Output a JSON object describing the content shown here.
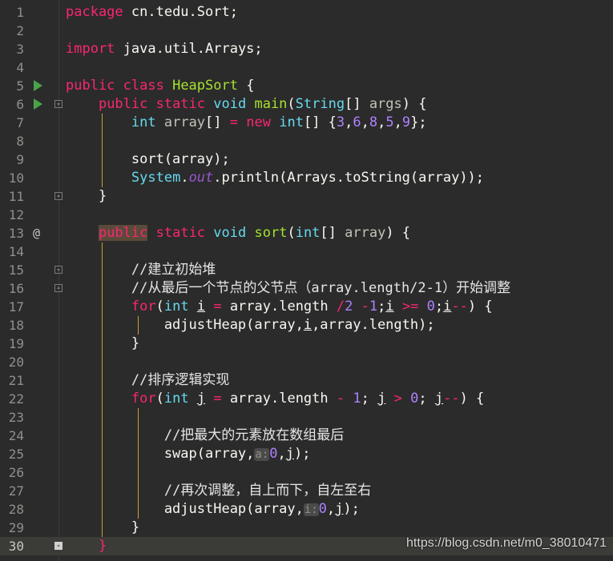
{
  "editor": {
    "file_class": "HeapSort",
    "current_line": 30
  },
  "lines": [
    {
      "n": "1",
      "html": "<span class=\"kw\">package</span> cn.tedu.Sort;"
    },
    {
      "n": "2",
      "html": ""
    },
    {
      "n": "3",
      "html": "<span class=\"kw\">import</span> java.util.Arrays;"
    },
    {
      "n": "4",
      "html": ""
    },
    {
      "n": "5",
      "html": "<span class=\"kw\">public class</span> <span class=\"fn\">HeapSort</span> {"
    },
    {
      "n": "6",
      "html": "    <span class=\"kw\">public static</span> <span class=\"ty\">void</span> <span class=\"fn\">main</span>(<span class=\"ty\">String</span>[] <span class=\"pm\">args</span>) {"
    },
    {
      "n": "7",
      "html": "        <span class=\"ty\">int</span> <span class=\"pm\">array</span>[] <span class=\"kw\">=</span> <span class=\"kw\">new</span> <span class=\"ty\">int</span>[] {<span class=\"num\">3</span>,<span class=\"num\">6</span>,<span class=\"num\">8</span>,<span class=\"num\">5</span>,<span class=\"num\">9</span>};"
    },
    {
      "n": "8",
      "html": ""
    },
    {
      "n": "9",
      "html": "        sort(array);"
    },
    {
      "n": "10",
      "html": "        <span class=\"ty\">System</span>.<span class=\"fld\">out</span>.println(Arrays.toString(array));"
    },
    {
      "n": "11",
      "html": "    }"
    },
    {
      "n": "12",
      "html": ""
    },
    {
      "n": "13",
      "html": "    <span class=\"kw hl\">public</span> <span class=\"kw\">static</span> <span class=\"ty\">void</span> <span class=\"fn\">sort</span>(<span class=\"ty\">int</span>[] <span class=\"pm\">array</span>) {"
    },
    {
      "n": "14",
      "html": ""
    },
    {
      "n": "15",
      "html": "        <span class=\"cmt\">//建立初始堆</span>"
    },
    {
      "n": "16",
      "html": "        <span class=\"cmt\">//从最后一个节点的父节点（array.length/2-1）开始调整</span>"
    },
    {
      "n": "17",
      "html": "        <span class=\"kw\">for</span>(<span class=\"ty\">int</span> <span class=\"u\">i</span> <span class=\"kw\">=</span> array.length <span class=\"kw\">/</span><span class=\"num\">2</span> <span class=\"kw\">-</span><span class=\"num\">1</span>;<span class=\"u\">i</span> <span class=\"kw\">&gt;=</span> <span class=\"num\">0</span>;<span class=\"u\">i</span><span class=\"kw\">--</span>) {"
    },
    {
      "n": "18",
      "html": "            adjustHeap(array,<span class=\"u\">i</span>,array.length);"
    },
    {
      "n": "19",
      "html": "        }"
    },
    {
      "n": "20",
      "html": ""
    },
    {
      "n": "21",
      "html": "        <span class=\"cmt\">//排序逻辑实现</span>"
    },
    {
      "n": "22",
      "html": "        <span class=\"kw\">for</span>(<span class=\"ty\">int</span> <span class=\"u\">j</span> <span class=\"kw\">=</span> array.length <span class=\"kw\">-</span> <span class=\"num\">1</span>; <span class=\"u\">j</span> <span class=\"kw\">&gt;</span> <span class=\"num\">0</span>; <span class=\"u\">j</span><span class=\"kw\">--</span>) {"
    },
    {
      "n": "23",
      "html": ""
    },
    {
      "n": "24",
      "html": "            <span class=\"cmt\">//把最大的元素放在数组最后</span>"
    },
    {
      "n": "25",
      "html": "            swap(array,<span class=\"hint\">a:</span><span class=\"num\">0</span>,<span class=\"u\">j</span>);"
    },
    {
      "n": "26",
      "html": ""
    },
    {
      "n": "27",
      "html": "            <span class=\"cmt\">//再次调整，自上而下，自左至右</span>"
    },
    {
      "n": "28",
      "html": "            adjustHeap(array,<span class=\"hint\">i:</span><span class=\"num\">0</span>,<span class=\"u\">j</span>);"
    },
    {
      "n": "29",
      "html": "        }"
    },
    {
      "n": "30",
      "html": "    <span class=\"kw\">}</span>"
    }
  ],
  "gutter": {
    "run_lines": [
      5,
      6
    ],
    "override_lines": [
      13
    ],
    "fold_open_lines": [
      6,
      15
    ],
    "fold_close_lines": [
      11,
      16
    ],
    "fold_end_lines": [
      30
    ]
  },
  "colors": {
    "background": "#2b2b2b",
    "keyword": "#f92672",
    "type": "#66d9ef",
    "function": "#a6e22e",
    "number": "#ae81ff",
    "guide": "#c9a033"
  },
  "watermark": "https://blog.csdn.net/m0_38010471"
}
